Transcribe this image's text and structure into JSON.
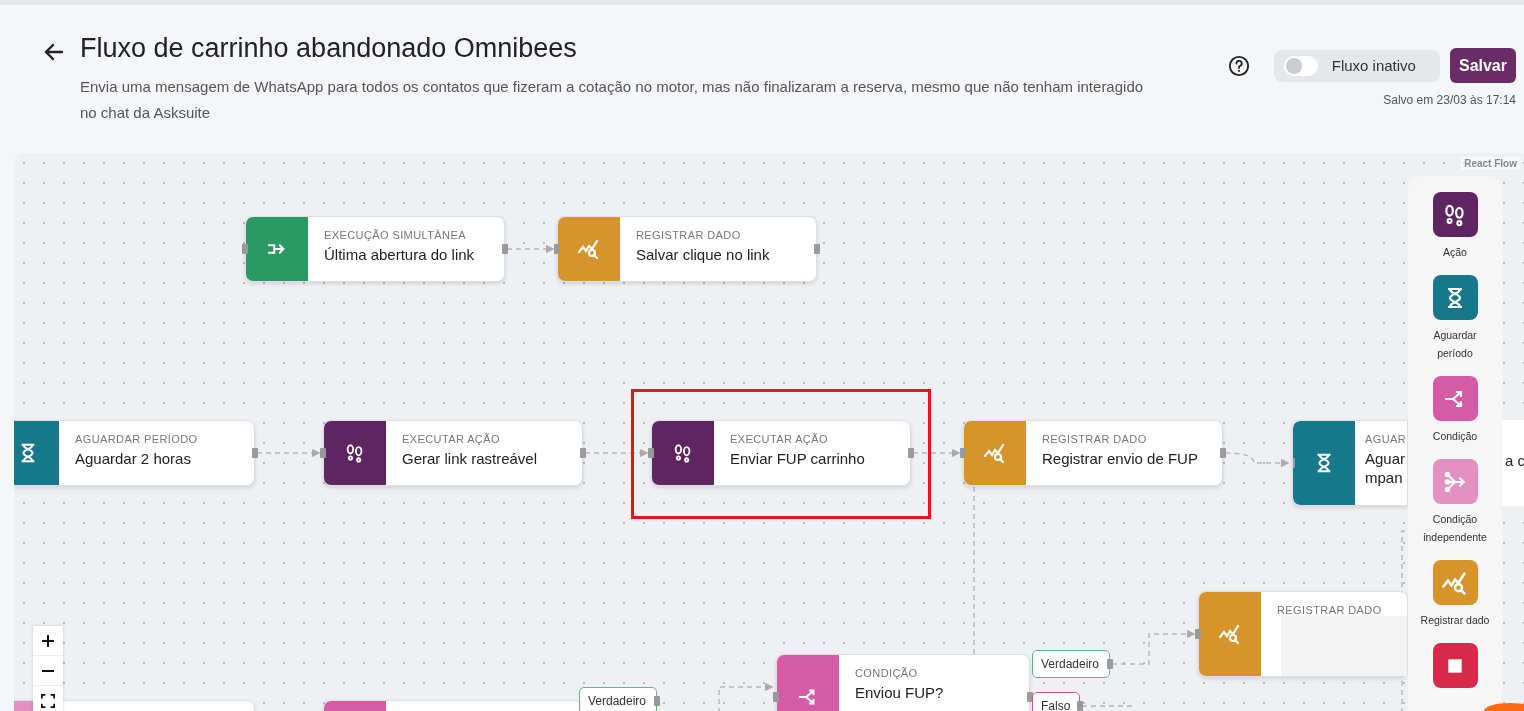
{
  "header": {
    "title": "Fluxo de carrinho abandonado Omnibees",
    "description": "Envia uma mensagem de WhatsApp para todos os contatos que fizeram a cotação no motor, mas não finalizaram a reserva, mesmo que não tenham interagido no chat da Asksuite",
    "toggle": {
      "label": "Fluxo inativo",
      "on": false
    },
    "save_button": "Salvar",
    "saved_at": "Salvo em 23/03 às 17:14"
  },
  "canvas": {
    "attribution": "React Flow",
    "nodes": [
      {
        "kind": "parallel",
        "label": "EXECUÇÃO SIMULTÂNEA",
        "title": "Última abertura do link",
        "highlighted": false
      },
      {
        "kind": "record",
        "label": "REGISTRAR DADO",
        "title": "Salvar clique no link",
        "highlighted": false
      },
      {
        "kind": "wait",
        "label": "AGUARDAR PERÍODO",
        "title": "Aguardar 2 horas",
        "highlighted": false
      },
      {
        "kind": "action",
        "label": "EXECUTAR AÇÃO",
        "title": "Gerar link rastreável",
        "highlighted": false
      },
      {
        "kind": "action",
        "label": "EXECUTAR AÇÃO",
        "title": "Enviar FUP carrinho",
        "highlighted": true
      },
      {
        "kind": "record",
        "label": "REGISTRAR DADO",
        "title": "Registrar envio de FUP",
        "highlighted": false
      },
      {
        "kind": "wait",
        "label": "AGUAR",
        "title": "Aguar",
        "title_2": "mpan",
        "title_tail": "a c",
        "highlighted": false
      },
      {
        "kind": "record",
        "label": "REGISTRAR DADO",
        "highlighted": false
      },
      {
        "kind": "condition",
        "label": "CONDIÇÃO",
        "title": "Enviou FUP?",
        "highlighted": false
      },
      {
        "kind": "independent",
        "highlighted": false
      },
      {
        "kind": "condition",
        "highlighted": false
      }
    ],
    "branches": [
      {
        "kind": "true",
        "label": "Verdadeiro"
      },
      {
        "kind": "false",
        "label": "Falso"
      },
      {
        "kind": "true",
        "label": "Verdadeiro"
      }
    ],
    "palette": [
      {
        "kind": "action",
        "label": "Ação"
      },
      {
        "kind": "wait",
        "label": "Aguardar período"
      },
      {
        "kind": "condition",
        "label": "Condição"
      },
      {
        "kind": "independent",
        "label": "Condição independente"
      },
      {
        "kind": "record",
        "label": "Registrar dado"
      },
      {
        "kind": "stop"
      }
    ]
  }
}
